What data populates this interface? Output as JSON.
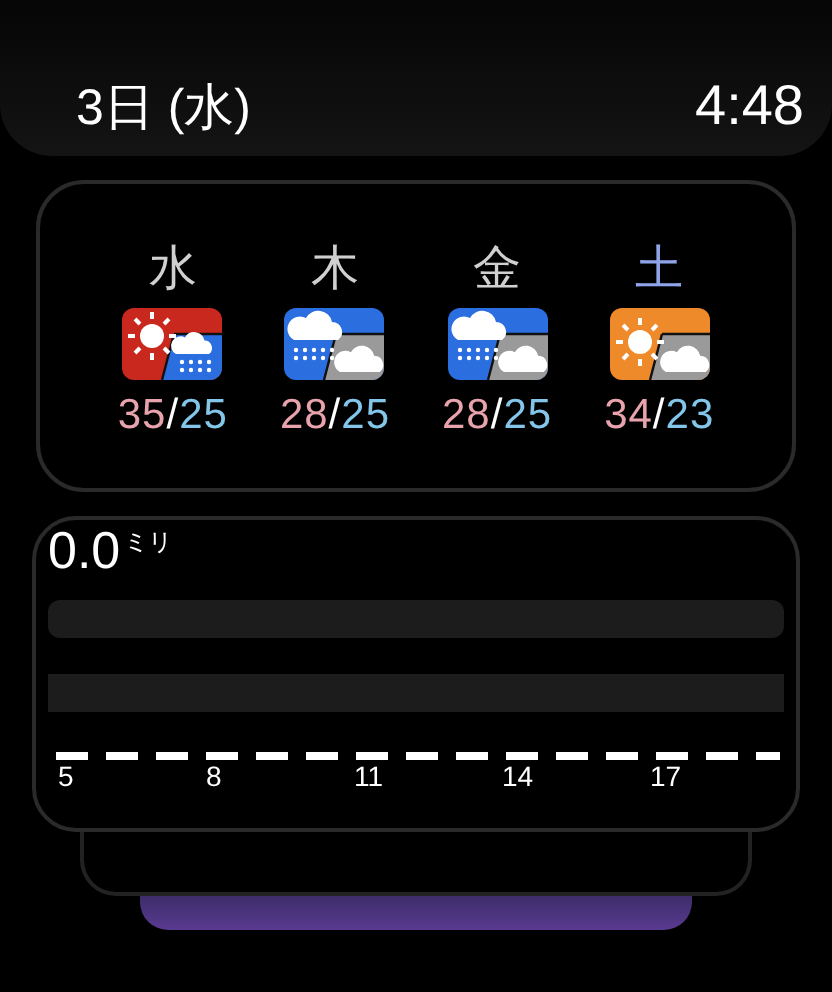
{
  "header": {
    "date": "3日 (水)",
    "time": "4:48"
  },
  "forecast": [
    {
      "day": "水",
      "color": "#d0d0d0",
      "kind": "hot_rain",
      "high": "35",
      "separator": "/",
      "low": "25"
    },
    {
      "day": "木",
      "color": "#d0d0d0",
      "kind": "rain_cloud",
      "high": "28",
      "separator": "/",
      "low": "25"
    },
    {
      "day": "金",
      "color": "#d0d0d0",
      "kind": "rain_cloud",
      "high": "28",
      "separator": "/",
      "low": "25"
    },
    {
      "day": "土",
      "color": "#8fa4e8",
      "kind": "sun_cloud",
      "high": "34",
      "separator": "/",
      "low": "23"
    }
  ],
  "rain": {
    "amount": "0.0",
    "unit": "ミリ",
    "hours": [
      "5",
      "8",
      "11",
      "14",
      "17"
    ]
  }
}
